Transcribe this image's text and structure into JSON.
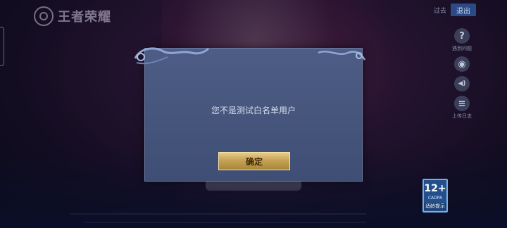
{
  "header": {
    "logo_text": "王者荣耀",
    "guoqu_label": "过去",
    "exit_label": "退出"
  },
  "side_menu": [
    {
      "icon": "question-icon",
      "glyph": "?",
      "label": "遇到问题"
    },
    {
      "icon": "gamepad-icon",
      "glyph": "◉",
      "label": ""
    },
    {
      "icon": "speaker-icon",
      "glyph": "◀)",
      "label": ""
    },
    {
      "icon": "document-icon",
      "glyph": "≡",
      "label": "上传日志"
    }
  ],
  "dialog": {
    "message": "您不是测试白名单用户",
    "confirm_label": "确定"
  },
  "age_rating": {
    "number": "12+",
    "sub": "CADPA",
    "footer": "适龄提示"
  },
  "colors": {
    "confirm_gold": "#c6a255",
    "dialog_bg": "#4d5d85",
    "exit_blue": "#2c4a86"
  }
}
